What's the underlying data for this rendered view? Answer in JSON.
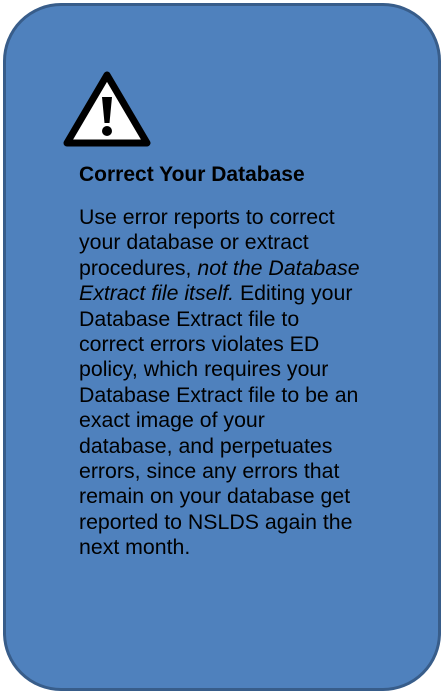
{
  "callout": {
    "icon": "warning-triangle-icon",
    "title": "Correct Your Database",
    "lines": [
      "Use error reports to correct",
      "your database or extract",
      "procedures, ",
      "Extract file itself.",
      "Database Extract file to",
      "correct errors violates ED",
      "policy, which requires your",
      "Database Extract file to be an",
      "exact image of your",
      "database, and perpetuates",
      "errors, since any errors that",
      "remain on your database get",
      "reported to NSLDS again the",
      "next month."
    ],
    "italic_line3": "not the Database",
    "plain_line4": " Editing your",
    "colors": {
      "background": "#4f81bd",
      "border": "#385d8a",
      "text": "#000000"
    }
  }
}
